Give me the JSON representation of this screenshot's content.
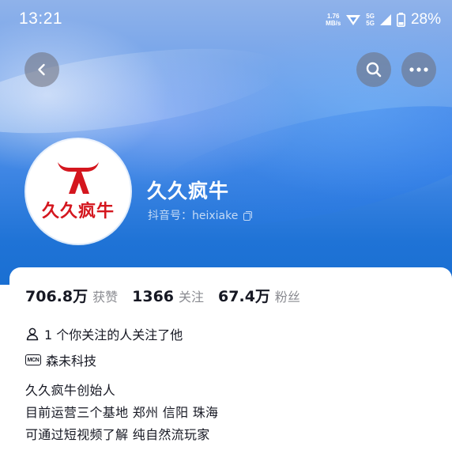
{
  "status_bar": {
    "time": "13:21",
    "net_speed_value": "1.76",
    "net_speed_unit": "MB/s",
    "network_top": "5G",
    "network_bottom": "5G",
    "battery": "28%"
  },
  "header": {
    "back_icon": "chevron-left-icon",
    "search_icon": "search-icon",
    "more_icon": "more-dots-icon",
    "gradient_color": "#3f86e4"
  },
  "profile": {
    "avatar_text": "久久疯牛",
    "avatar_color": "#d4161e",
    "nickname": "久久疯牛",
    "douyin_id": "抖音号：heixiake"
  },
  "stats": [
    {
      "value": "706.8万",
      "label": "获赞"
    },
    {
      "value": "1366",
      "label": "关注"
    },
    {
      "value": "67.4万",
      "label": "粉丝"
    }
  ],
  "info": {
    "mutual_follow": "1 个你关注的人关注了他",
    "mcn_badge": "MCN",
    "mcn_org": "森未科技"
  },
  "bio": [
    "久久疯牛创始人",
    "目前运营三个基地 郑州 信阳 珠海",
    "可通过短视频了解  纯自然流玩家"
  ]
}
